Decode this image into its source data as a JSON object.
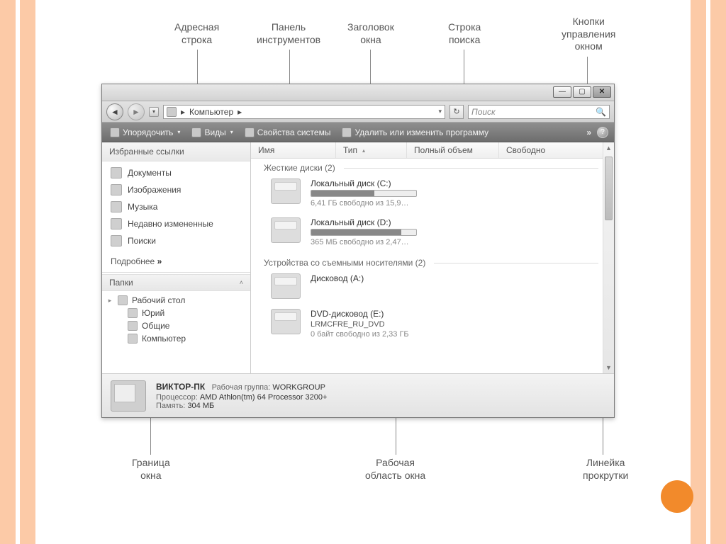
{
  "annotations": {
    "address_bar": "Адресная\nстрока",
    "toolbar": "Панель\nинструментов",
    "title": "Заголовок\nокна",
    "search": "Строка\nпоиска",
    "winbtns": "Кнопки\nуправления\nокном",
    "border": "Граница\nокна",
    "workarea": "Рабочая\nобласть окна",
    "scrollbar": "Линейка\nпрокрутки"
  },
  "nav": {
    "breadcrumb_icon": "🖳",
    "breadcrumb1": "Компьютер",
    "breadcrumb_sep": "▸",
    "search_placeholder": "Поиск"
  },
  "toolbar": {
    "organize": "Упорядочить",
    "views": "Виды",
    "properties": "Свойства системы",
    "uninstall": "Удалить или изменить программу",
    "more": "»"
  },
  "sidebar": {
    "fav_header": "Избранные ссылки",
    "items": [
      {
        "label": "Документы"
      },
      {
        "label": "Изображения"
      },
      {
        "label": "Музыка"
      },
      {
        "label": "Недавно измененные"
      },
      {
        "label": "Поиски"
      }
    ],
    "more": "Подробнее",
    "more_symbol": "»",
    "folders_header": "Папки",
    "tree": {
      "desktop": "Рабочий стол",
      "user": "Юрий",
      "public": "Общие",
      "computer": "Компьютер"
    }
  },
  "columns": {
    "name": "Имя",
    "type": "Тип",
    "total": "Полный объем",
    "free": "Свободно"
  },
  "groups": {
    "hdd": "Жесткие диски (2)",
    "removable": "Устройства со съемными носителями (2)"
  },
  "drives": {
    "c": {
      "name": "Локальный диск (C:)",
      "sub": "6,41 ГБ свободно из 15,9…",
      "fill": 60
    },
    "d": {
      "name": "Локальный диск (D:)",
      "sub": "365 МБ свободно из 2,47…",
      "fill": 86
    },
    "a": {
      "name": "Дисковод (A:)",
      "sub": ""
    },
    "e": {
      "name": "DVD-дисковод (E:)",
      "label": "LRMCFRE_RU_DVD",
      "sub": "0 байт свободно из 2,33 ГБ"
    }
  },
  "status": {
    "host": "ВИКТОР-ПК",
    "workgroup_k": "Рабочая группа:",
    "workgroup_v": "WORKGROUP",
    "cpu_k": "Процессор:",
    "cpu_v": "AMD Athlon(tm) 64 Processor 3200+",
    "mem_k": "Память:",
    "mem_v": "304 МБ"
  }
}
